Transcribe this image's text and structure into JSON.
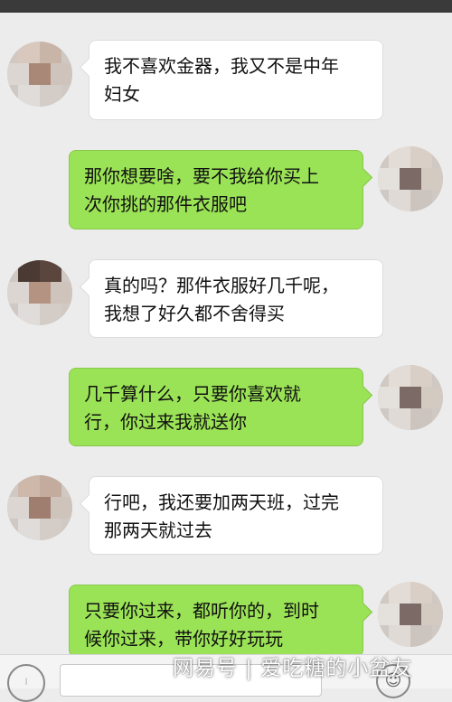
{
  "messages": [
    {
      "side": "in",
      "text_line1": "我不喜欢金器，我又不是中年",
      "text_line2": "妇女"
    },
    {
      "side": "out",
      "text_line1": "那你想要啥，要不我给你买上",
      "text_line2": "次你挑的那件衣服吧"
    },
    {
      "side": "in",
      "text_line1": "真的吗？那件衣服好几千呢，",
      "text_line2": "我想了好久都不舍得买"
    },
    {
      "side": "out",
      "text_line1": "几千算什么，只要你喜欢就",
      "text_line2": "行，你过来我就送你"
    },
    {
      "side": "in",
      "text_line1": "行吧，我还要加两天班，过完",
      "text_line2": "那两天就过去"
    },
    {
      "side": "out",
      "text_line1": "只要你过来，都听你的，到时",
      "text_line2": "候你过来，带你好好玩玩"
    }
  ],
  "watermark": "网易号 | 爱吃糖的小盆友",
  "icons": {
    "voice": "voice-icon",
    "emoji": "emoji-icon"
  },
  "colors": {
    "background": "#ececec",
    "outgoing_bubble": "#9be356",
    "incoming_bubble": "#ffffff"
  }
}
